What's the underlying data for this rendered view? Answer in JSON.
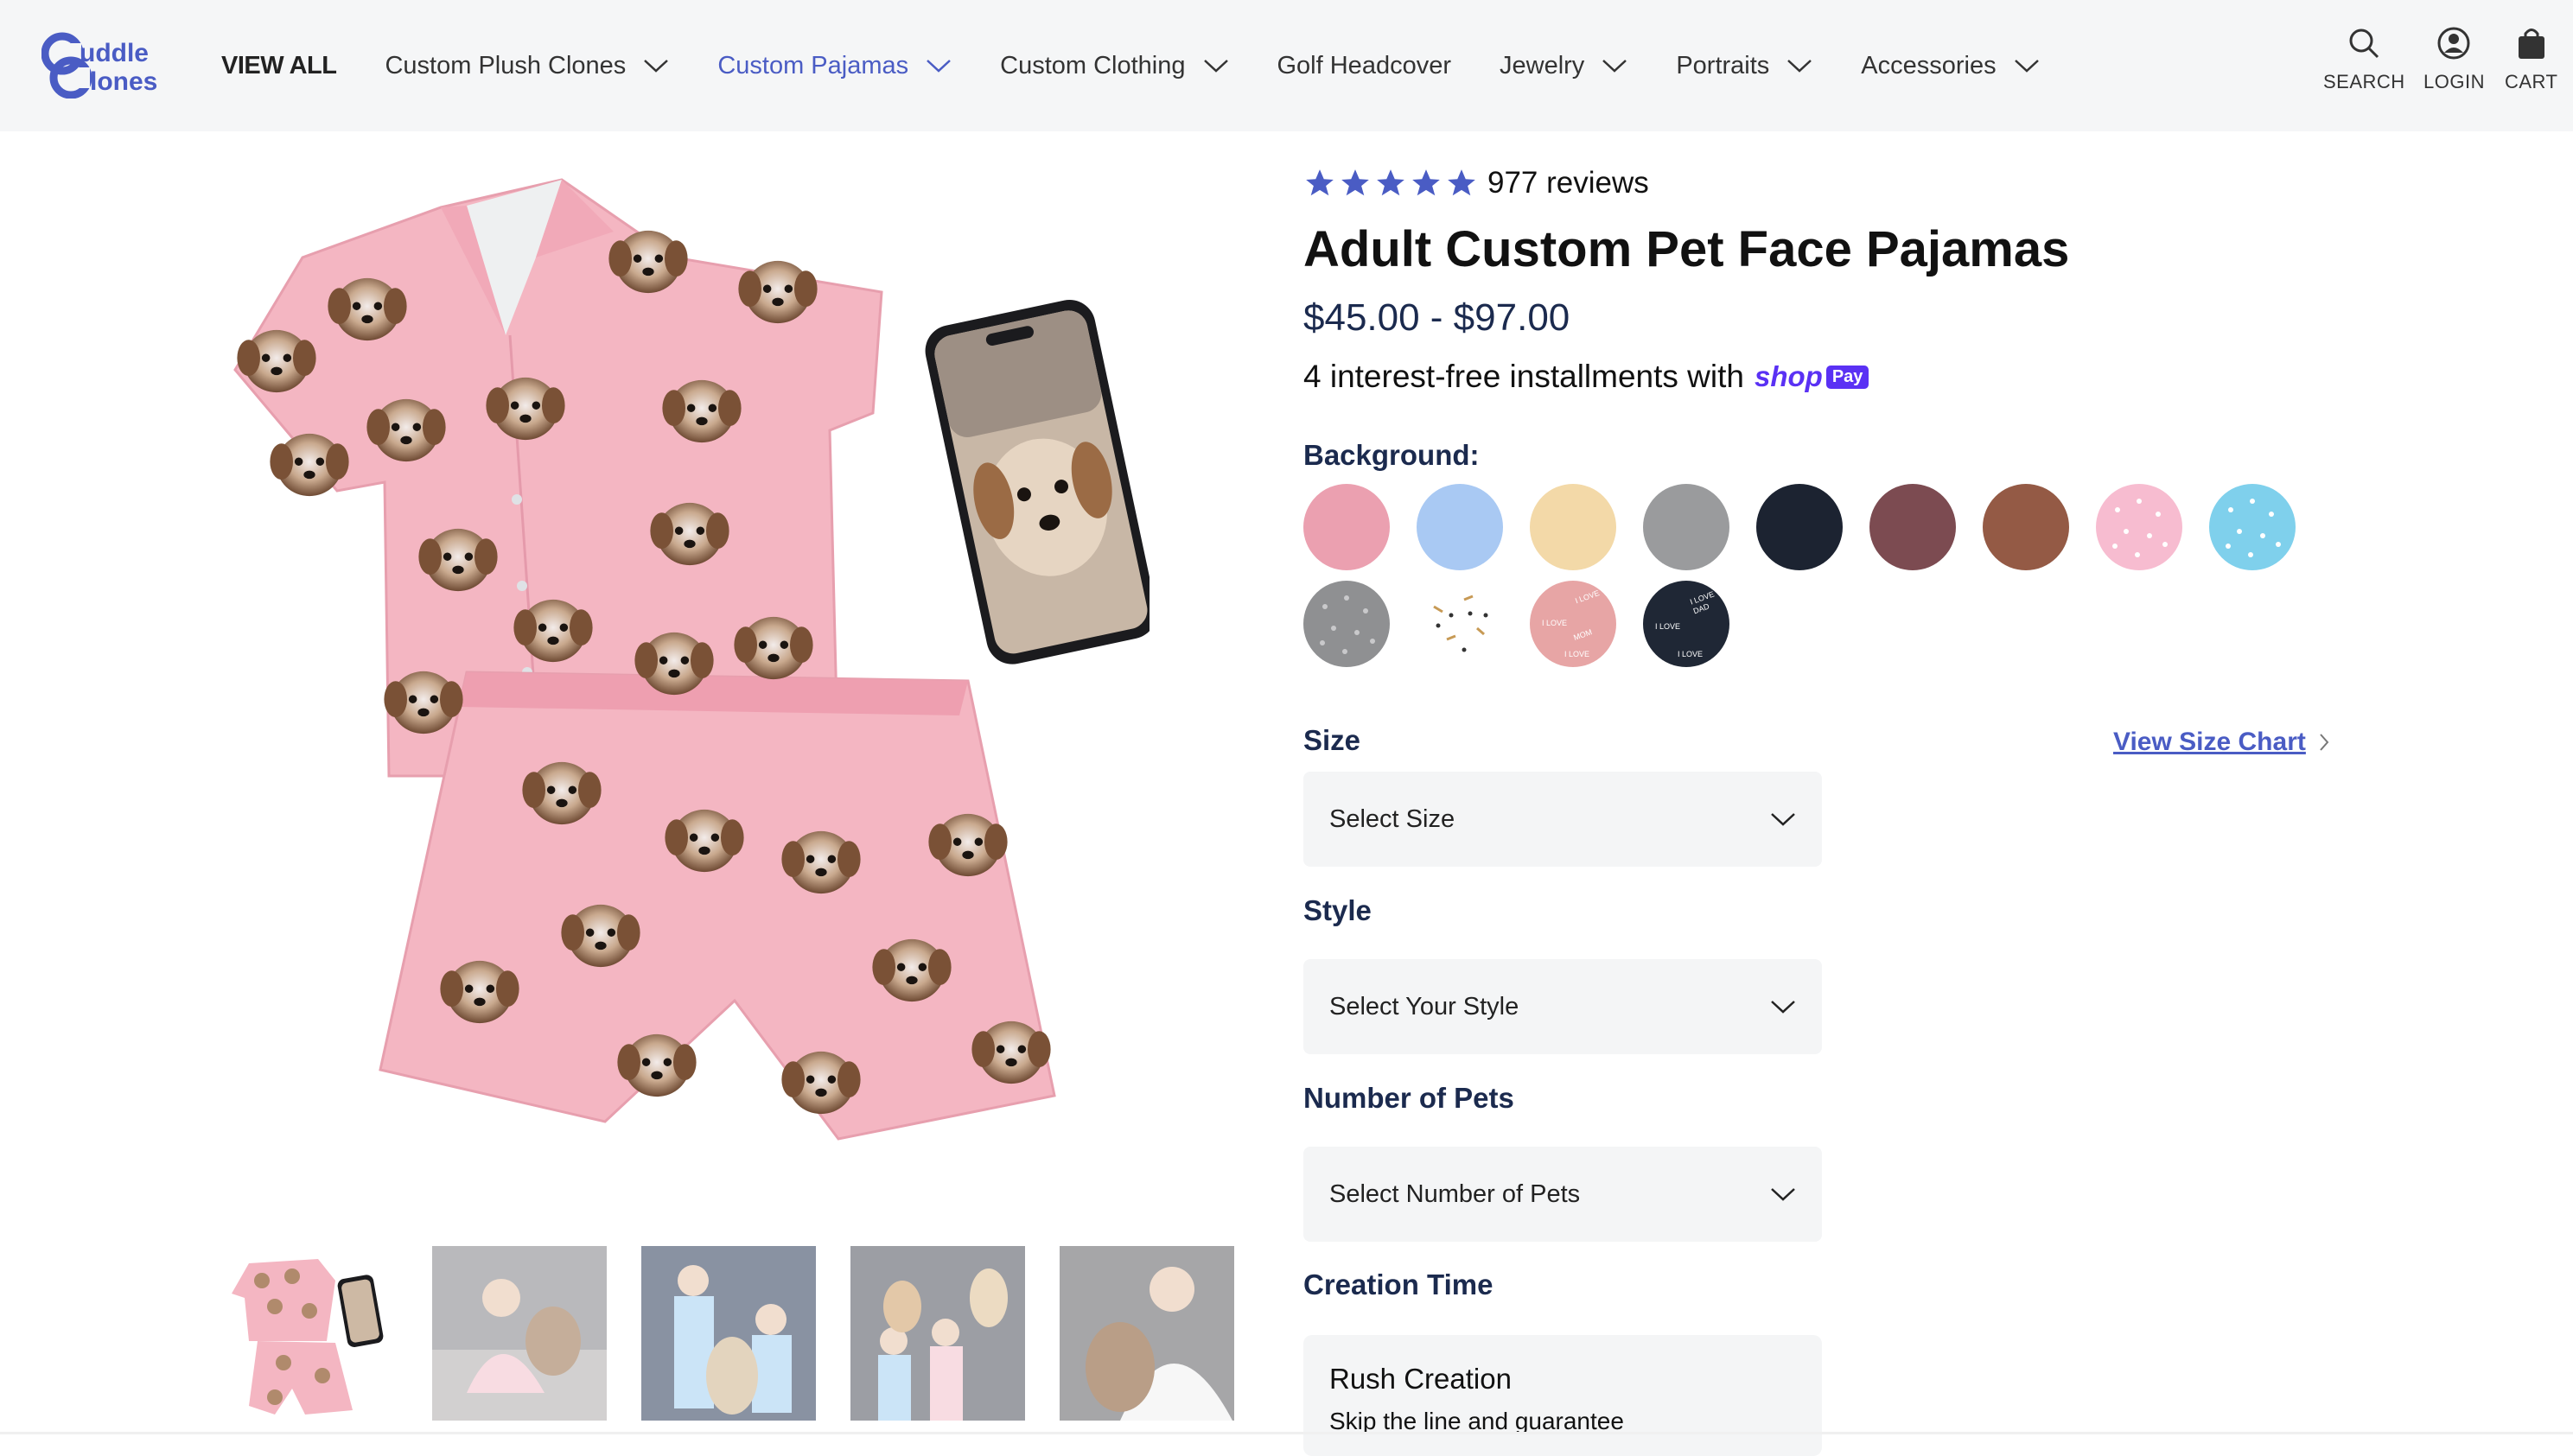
{
  "header": {
    "logo_text": "Cuddle Clones",
    "nav": [
      {
        "label": "VIEW ALL",
        "dropdown": false
      },
      {
        "label": "Custom Plush Clones",
        "dropdown": true
      },
      {
        "label": "Custom Pajamas",
        "dropdown": true,
        "active": true
      },
      {
        "label": "Custom Clothing",
        "dropdown": true
      },
      {
        "label": "Golf Headcover",
        "dropdown": false
      },
      {
        "label": "Jewelry",
        "dropdown": true
      },
      {
        "label": "Portraits",
        "dropdown": true
      },
      {
        "label": "Accessories",
        "dropdown": true
      }
    ],
    "utility": {
      "search": "SEARCH",
      "login": "LOGIN",
      "cart": "CART"
    }
  },
  "product": {
    "rating_stars": 5,
    "review_count": "977 reviews",
    "title": "Adult Custom Pet Face Pajamas",
    "price": "$45.00 - $97.00",
    "installments": "4 interest-free installments with",
    "shoppay": {
      "shop": "shop",
      "pay": "Pay"
    },
    "background_label": "Background:",
    "swatches": [
      {
        "name": "pink",
        "color": "#eba0b0"
      },
      {
        "name": "light-blue",
        "color": "#a9c9f3"
      },
      {
        "name": "cream",
        "color": "#f3d9a8"
      },
      {
        "name": "gray",
        "color": "#9a9b9d"
      },
      {
        "name": "navy",
        "color": "#1c2331"
      },
      {
        "name": "maroon",
        "color": "#7c4b51"
      },
      {
        "name": "brown",
        "color": "#945a45"
      },
      {
        "name": "pink-dots",
        "color": "#f7bcd0"
      },
      {
        "name": "blue-dots",
        "color": "#7fd0ec"
      },
      {
        "name": "gray-dots",
        "color": "#8f9092"
      },
      {
        "name": "bones-pattern",
        "color": "#ffffff"
      },
      {
        "name": "love-mom-pattern",
        "color": "#e7a5a5"
      },
      {
        "name": "love-dad-pattern",
        "color": "#1f2735"
      }
    ],
    "size_label": "Size",
    "size_chart_link": "View Size Chart",
    "size_select": "Select Size",
    "style_label": "Style",
    "style_select": "Select Your Style",
    "pets_label": "Number of Pets",
    "pets_select": "Select Number of Pets",
    "creation_label": "Creation Time",
    "rush_title": "Rush Creation",
    "rush_desc": "Skip the line and guarantee"
  },
  "gallery": {
    "thumbnails": [
      "pajama-set",
      "child-with-dog",
      "kids-with-dog",
      "family-with-dog",
      "woman-with-dog"
    ]
  },
  "colors": {
    "accent": "#4a5cc4",
    "price": "#1b2a4e",
    "pajama_pink": "#f4b6c2",
    "shoppay": "#5a31f4"
  }
}
